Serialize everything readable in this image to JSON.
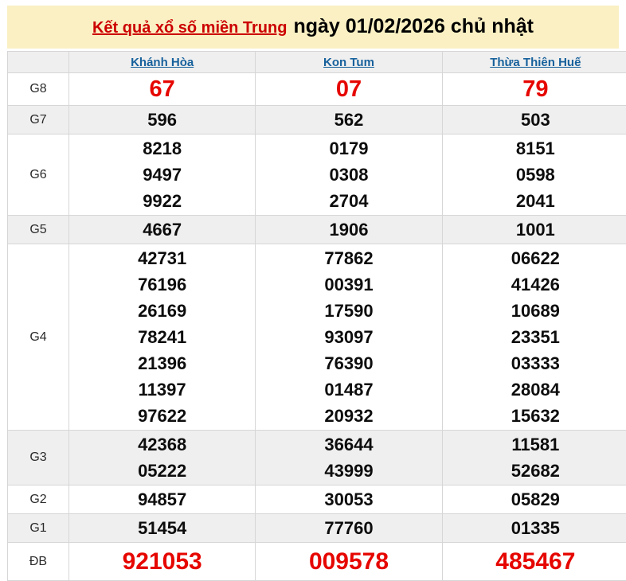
{
  "header": {
    "title_link": "Kết quả xổ số miền Trung",
    "date_text": "ngày 01/02/2026 chủ nhật"
  },
  "table": {
    "columns": [
      "Khánh Hòa",
      "Kon Tum",
      "Thừa Thiên Huế"
    ],
    "rows": [
      {
        "label": "G8",
        "style": "red",
        "striped": false,
        "values": [
          [
            "67"
          ],
          [
            "07"
          ],
          [
            "79"
          ]
        ]
      },
      {
        "label": "G7",
        "style": "normal",
        "striped": true,
        "values": [
          [
            "596"
          ],
          [
            "562"
          ],
          [
            "503"
          ]
        ]
      },
      {
        "label": "G6",
        "style": "normal",
        "striped": false,
        "values": [
          [
            "8218",
            "9497",
            "9922"
          ],
          [
            "0179",
            "0308",
            "2704"
          ],
          [
            "8151",
            "0598",
            "2041"
          ]
        ]
      },
      {
        "label": "G5",
        "style": "normal",
        "striped": true,
        "values": [
          [
            "4667"
          ],
          [
            "1906"
          ],
          [
            "1001"
          ]
        ]
      },
      {
        "label": "G4",
        "style": "normal",
        "striped": false,
        "values": [
          [
            "42731",
            "76196",
            "26169",
            "78241",
            "21396",
            "11397",
            "97622"
          ],
          [
            "77862",
            "00391",
            "17590",
            "93097",
            "76390",
            "01487",
            "20932"
          ],
          [
            "06622",
            "41426",
            "10689",
            "23351",
            "03333",
            "28084",
            "15632"
          ]
        ]
      },
      {
        "label": "G3",
        "style": "normal",
        "striped": true,
        "values": [
          [
            "42368",
            "05222"
          ],
          [
            "36644",
            "43999"
          ],
          [
            "11581",
            "52682"
          ]
        ]
      },
      {
        "label": "G2",
        "style": "normal",
        "striped": false,
        "values": [
          [
            "94857"
          ],
          [
            "30053"
          ],
          [
            "05829"
          ]
        ]
      },
      {
        "label": "G1",
        "style": "normal",
        "striped": true,
        "values": [
          [
            "51454"
          ],
          [
            "77760"
          ],
          [
            "01335"
          ]
        ]
      },
      {
        "label": "ĐB",
        "style": "red-large",
        "striped": false,
        "values": [
          [
            "921053"
          ],
          [
            "009578"
          ],
          [
            "485467"
          ]
        ]
      }
    ]
  },
  "colors": {
    "banner_bg": "#faf0c3",
    "link_red": "#cc0000",
    "link_blue": "#17619c",
    "number_red": "#e60600",
    "stripe": "#efefef",
    "border": "#d6d6d6"
  }
}
